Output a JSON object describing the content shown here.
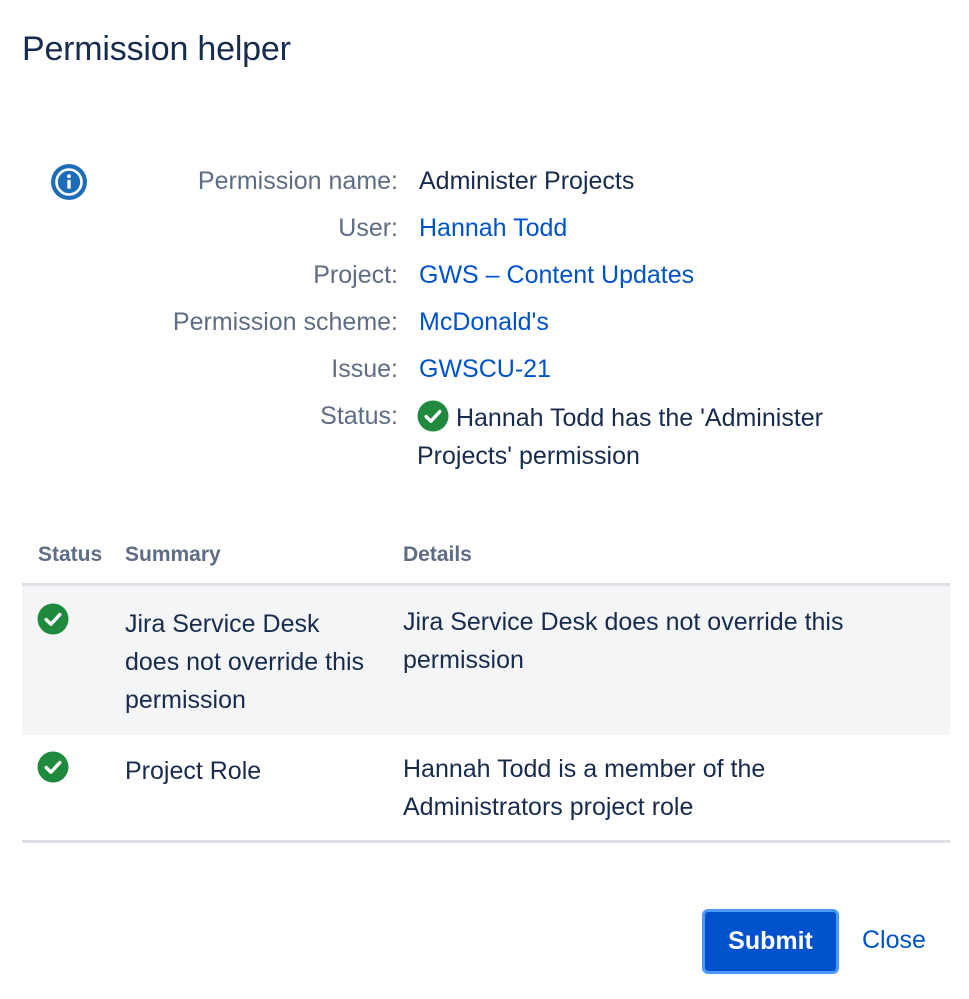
{
  "dialog": {
    "title": "Permission helper"
  },
  "icons": {
    "info": "info-circle-icon",
    "success": "check-circle-icon"
  },
  "colors": {
    "link": "#0052cc",
    "label": "#5e6c84",
    "text": "#172b4d",
    "success": "#1f8a3e",
    "info": "#1c6cb8",
    "primary_button": "#0052cc",
    "focus_ring": "#4c9aff",
    "row_highlight": "#f4f5f7"
  },
  "details": {
    "permission_name_label": "Permission name:",
    "permission_name_value": "Administer Projects",
    "user_label": "User:",
    "user_value": "Hannah Todd",
    "project_label": "Project:",
    "project_value": "GWS – Content Updates",
    "scheme_label": "Permission scheme:",
    "scheme_value": "McDonald's",
    "issue_label": "Issue:",
    "issue_value": "GWSCU-21",
    "status_label": "Status:",
    "status_value": "Hannah Todd has the 'Administer Projects' permission"
  },
  "table": {
    "columns": [
      "Status",
      "Summary",
      "Details"
    ],
    "rows": [
      {
        "summary": "Jira Service Desk does not override this permission",
        "details": "Jira Service Desk does not override this permission"
      },
      {
        "summary": "Project Role",
        "details": "Hannah Todd is a member of the Administrators project role"
      }
    ]
  },
  "actions": {
    "submit_label": "Submit",
    "close_label": "Close"
  }
}
